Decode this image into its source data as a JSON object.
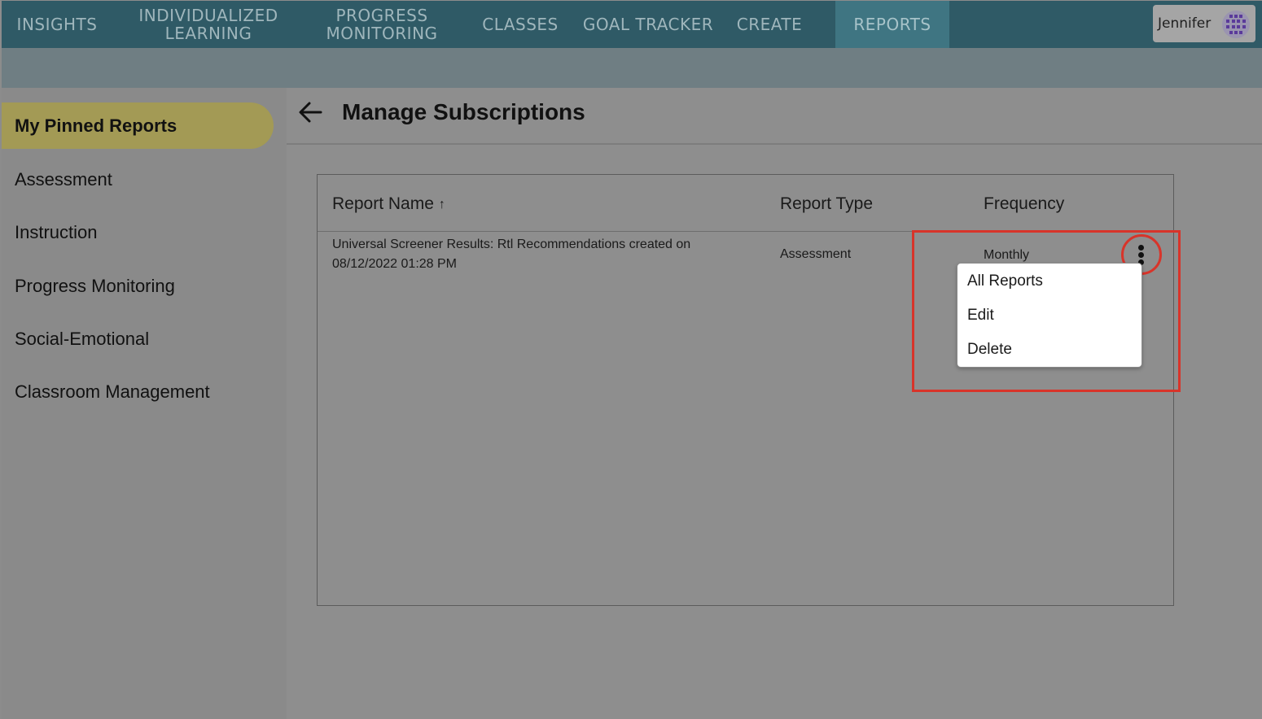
{
  "nav": {
    "items": [
      {
        "label": "INSIGHTS"
      },
      {
        "line1": "INDIVIDUALIZED",
        "line2": "LEARNING"
      },
      {
        "line1": "PROGRESS",
        "line2": "MONITORING"
      },
      {
        "label": "CLASSES"
      },
      {
        "label": "GOAL TRACKER"
      },
      {
        "label": "CREATE"
      },
      {
        "label": "REPORTS"
      }
    ],
    "active_index": 6,
    "user_name": "Jennifer"
  },
  "sidebar": {
    "items": [
      {
        "label": "My Pinned Reports"
      },
      {
        "label": "Assessment"
      },
      {
        "label": "Instruction"
      },
      {
        "label": "Progress Monitoring"
      },
      {
        "label": "Social-Emotional"
      },
      {
        "label": "Classroom Management"
      }
    ]
  },
  "page": {
    "title": "Manage Subscriptions"
  },
  "table": {
    "headers": {
      "name": "Report Name",
      "name_sort": "↑",
      "type": "Report Type",
      "frequency": "Frequency"
    },
    "rows": [
      {
        "name_line1": "Universal Screener Results: Rtl Recommendations created on",
        "name_line2": "08/12/2022 01:28 PM",
        "type": "Assessment",
        "frequency": "Monthly"
      }
    ]
  },
  "row_menu": {
    "items": [
      {
        "label": "All Reports"
      },
      {
        "label": "Edit"
      },
      {
        "label": "Delete"
      }
    ]
  },
  "colors": {
    "highlight": "#d8342a",
    "nav_bg": "#2f5a66",
    "active_nav": "#3f7582",
    "sidebar_active": "#a39a55"
  }
}
